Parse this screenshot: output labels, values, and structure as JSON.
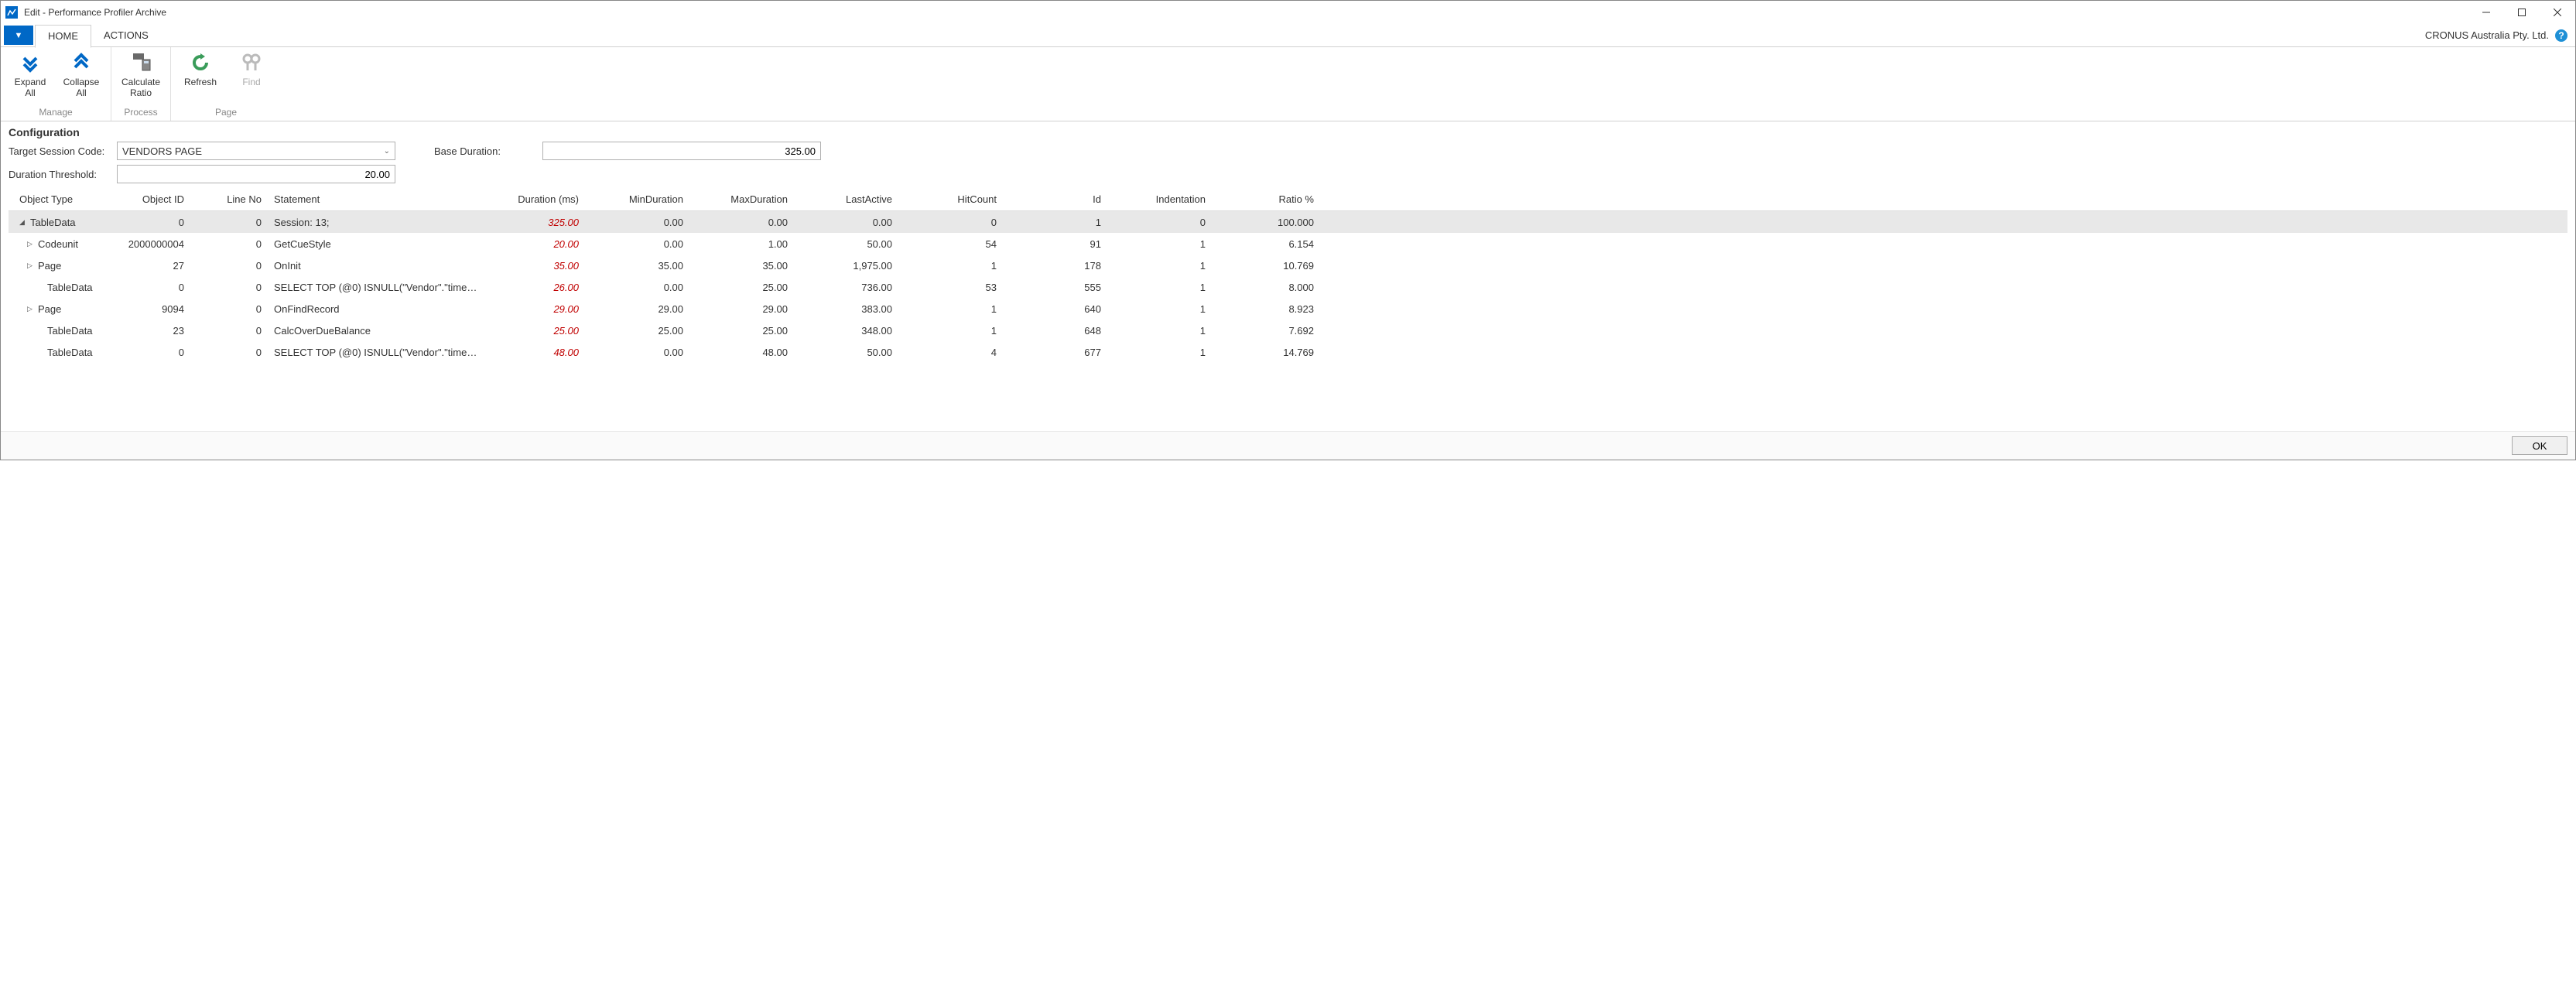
{
  "window": {
    "title": "Edit - Performance Profiler Archive"
  },
  "tabs": {
    "file_glyph": "▼",
    "home": "HOME",
    "actions": "ACTIONS"
  },
  "company": "CRONUS Australia Pty. Ltd.",
  "ribbon": {
    "expand_all": "Expand All",
    "collapse_all": "Collapse All",
    "calculate_ratio": "Calculate Ratio",
    "refresh": "Refresh",
    "find": "Find",
    "group_manage": "Manage",
    "group_process": "Process",
    "group_page": "Page"
  },
  "config": {
    "section_title": "Configuration",
    "target_session_label": "Target Session Code:",
    "target_session_value": "VENDORS PAGE",
    "duration_threshold_label": "Duration Threshold:",
    "duration_threshold_value": "20.00",
    "base_duration_label": "Base Duration:",
    "base_duration_value": "325.00"
  },
  "columns": {
    "objtype": "Object Type",
    "objid": "Object ID",
    "lineno": "Line No",
    "stmt": "Statement",
    "dur": "Duration (ms)",
    "mindur": "MinDuration",
    "maxdur": "MaxDuration",
    "lastactive": "LastActive",
    "hitcount": "HitCount",
    "id": "Id",
    "indent": "Indentation",
    "ratio": "Ratio %"
  },
  "rows": [
    {
      "toggle": "◢",
      "objtype": "TableData",
      "objid": "0",
      "lineno": "0",
      "stmt": "Session: 13;",
      "dur": "325.00",
      "min": "0.00",
      "max": "0.00",
      "last": "0.00",
      "hit": "0",
      "id": "1",
      "ind": "0",
      "ratio": "100.000",
      "sel": true,
      "indent": 0
    },
    {
      "toggle": "▷",
      "objtype": "Codeunit",
      "objid": "2000000004",
      "lineno": "0",
      "stmt": "GetCueStyle",
      "dur": "20.00",
      "min": "0.00",
      "max": "1.00",
      "last": "50.00",
      "hit": "54",
      "id": "91",
      "ind": "1",
      "ratio": "6.154",
      "indent": 1
    },
    {
      "toggle": "▷",
      "objtype": "Page",
      "objid": "27",
      "lineno": "0",
      "stmt": "OnInit",
      "dur": "35.00",
      "min": "35.00",
      "max": "35.00",
      "last": "1,975.00",
      "hit": "1",
      "id": "178",
      "ind": "1",
      "ratio": "10.769",
      "indent": 1
    },
    {
      "toggle": "",
      "objtype": "TableData",
      "objid": "0",
      "lineno": "0",
      "stmt": "SELECT TOP (@0) ISNULL(\"Vendor\".\"timest…",
      "dur": "26.00",
      "min": "0.00",
      "max": "25.00",
      "last": "736.00",
      "hit": "53",
      "id": "555",
      "ind": "1",
      "ratio": "8.000",
      "indent": 2
    },
    {
      "toggle": "▷",
      "objtype": "Page",
      "objid": "9094",
      "lineno": "0",
      "stmt": "OnFindRecord",
      "dur": "29.00",
      "min": "29.00",
      "max": "29.00",
      "last": "383.00",
      "hit": "1",
      "id": "640",
      "ind": "1",
      "ratio": "8.923",
      "indent": 1
    },
    {
      "toggle": "",
      "objtype": "TableData",
      "objid": "23",
      "lineno": "0",
      "stmt": "CalcOverDueBalance",
      "dur": "25.00",
      "min": "25.00",
      "max": "25.00",
      "last": "348.00",
      "hit": "1",
      "id": "648",
      "ind": "1",
      "ratio": "7.692",
      "indent": 2
    },
    {
      "toggle": "",
      "objtype": "TableData",
      "objid": "0",
      "lineno": "0",
      "stmt": "SELECT TOP (@0) ISNULL(\"Vendor\".\"timest…",
      "dur": "48.00",
      "min": "0.00",
      "max": "48.00",
      "last": "50.00",
      "hit": "4",
      "id": "677",
      "ind": "1",
      "ratio": "14.769",
      "indent": 2
    }
  ],
  "footer": {
    "ok": "OK"
  }
}
